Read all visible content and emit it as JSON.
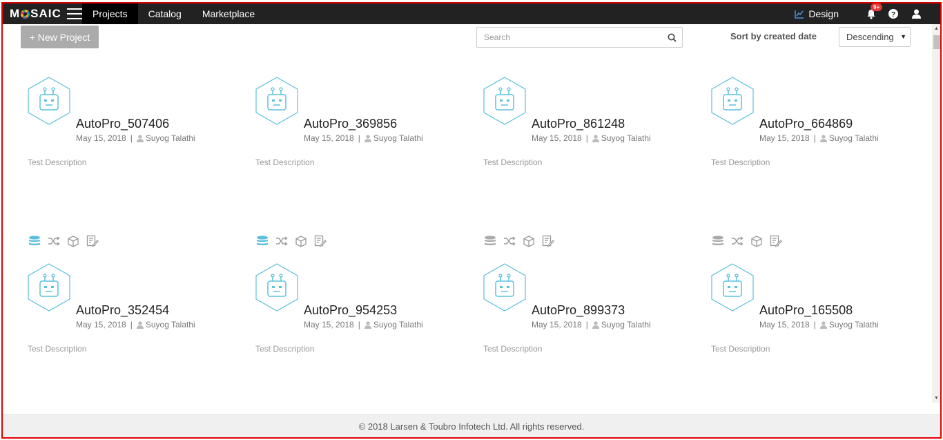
{
  "nav": {
    "logo": "MOSAIC",
    "tabs": [
      {
        "label": "Projects",
        "active": true
      },
      {
        "label": "Catalog",
        "active": false
      },
      {
        "label": "Marketplace",
        "active": false
      }
    ],
    "design_label": "Design",
    "notification_badge": "9+"
  },
  "toolbar": {
    "new_project_label": "+ New Project",
    "search_placeholder": "Search",
    "sort_label": "Sort by created date",
    "sort_value": "Descending"
  },
  "projects": [
    {
      "name": "AutoPro_507406",
      "date": "May 15, 2018",
      "owner": "Suyog Talathi",
      "description": "Test Description",
      "data_active": true
    },
    {
      "name": "AutoPro_369856",
      "date": "May 15, 2018",
      "owner": "Suyog Talathi",
      "description": "Test Description",
      "data_active": true
    },
    {
      "name": "AutoPro_861248",
      "date": "May 15, 2018",
      "owner": "Suyog Talathi",
      "description": "Test Description",
      "data_active": false
    },
    {
      "name": "AutoPro_664869",
      "date": "May 15, 2018",
      "owner": "Suyog Talathi",
      "description": "Test Description",
      "data_active": false
    },
    {
      "name": "AutoPro_352454",
      "date": "May 15, 2018",
      "owner": "Suyog Talathi",
      "description": "Test Description",
      "data_active": true
    },
    {
      "name": "AutoPro_954253",
      "date": "May 15, 2018",
      "owner": "Suyog Talathi",
      "description": "Test Description",
      "data_active": true
    },
    {
      "name": "AutoPro_899373",
      "date": "May 15, 2018",
      "owner": "Suyog Talathi",
      "description": "Test Description",
      "data_active": false
    },
    {
      "name": "AutoPro_165508",
      "date": "May 15, 2018",
      "owner": "Suyog Talathi",
      "description": "Test Description",
      "data_active": true
    }
  ],
  "card_icons": [
    "database-icon",
    "shuffle-icon",
    "cube-icon",
    "edit-note-icon"
  ],
  "colors": {
    "accent": "#5bc0de",
    "inactive": "#aaaaaa",
    "nav_bg": "#222222",
    "badge": "#e53935"
  },
  "footer": "© 2018 Larsen & Toubro Infotech Ltd. All rights reserved."
}
